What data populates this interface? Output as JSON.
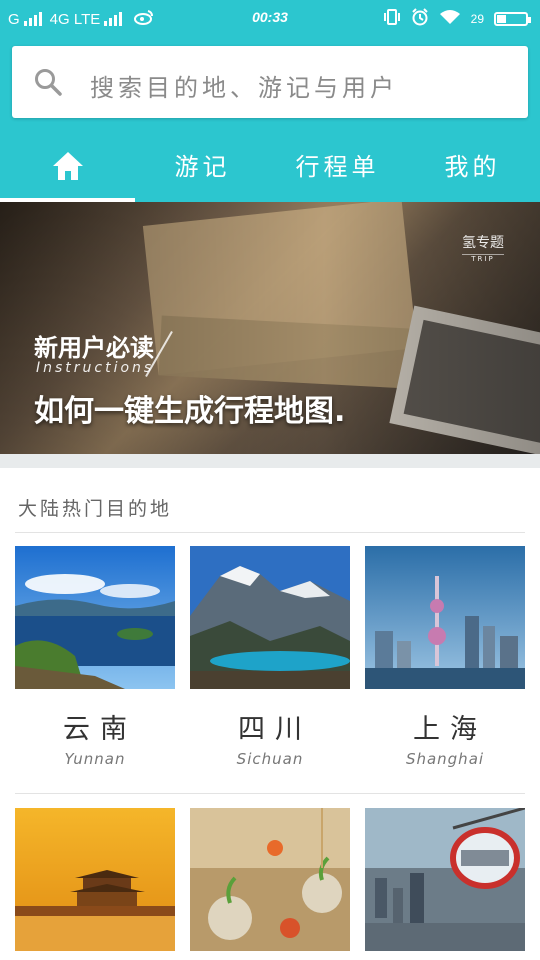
{
  "status_bar": {
    "carrier": "G",
    "network": "4G LTE",
    "time": "00:33",
    "battery_text": "29",
    "battery_level_fraction": 0.29
  },
  "search": {
    "placeholder": "搜索目的地、游记与用户"
  },
  "tabs": [
    {
      "label": "",
      "icon": "home-icon",
      "active": true
    },
    {
      "label": "游记",
      "active": false
    },
    {
      "label": "行程单",
      "active": false
    },
    {
      "label": "我的",
      "active": false
    }
  ],
  "banner": {
    "kicker": "新用户必读",
    "kicker_en": "Instructions",
    "headline": "如何一键生成行程地图.",
    "brand": "氢专题",
    "brand_sub": "TRIP"
  },
  "section": {
    "title": "大陆热门目的地"
  },
  "destinations": [
    {
      "name_zh": "云南",
      "name_en": "Yunnan",
      "image": "lake-islands-photo"
    },
    {
      "name_zh": "四川",
      "name_en": "Sichuan",
      "image": "snow-mountain-lake-photo"
    },
    {
      "name_zh": "上海",
      "name_en": "Shanghai",
      "image": "city-skyline-photo"
    },
    {
      "name_zh": "",
      "name_en": "",
      "image": "forbidden-city-tower-photo"
    },
    {
      "name_zh": "",
      "name_en": "",
      "image": "hanging-bulb-plants-photo"
    },
    {
      "name_zh": "",
      "name_en": "",
      "image": "ferris-wheel-city-photo"
    }
  ],
  "colors": {
    "accent": "#2cc6cf",
    "separator": "#e8ebec"
  }
}
